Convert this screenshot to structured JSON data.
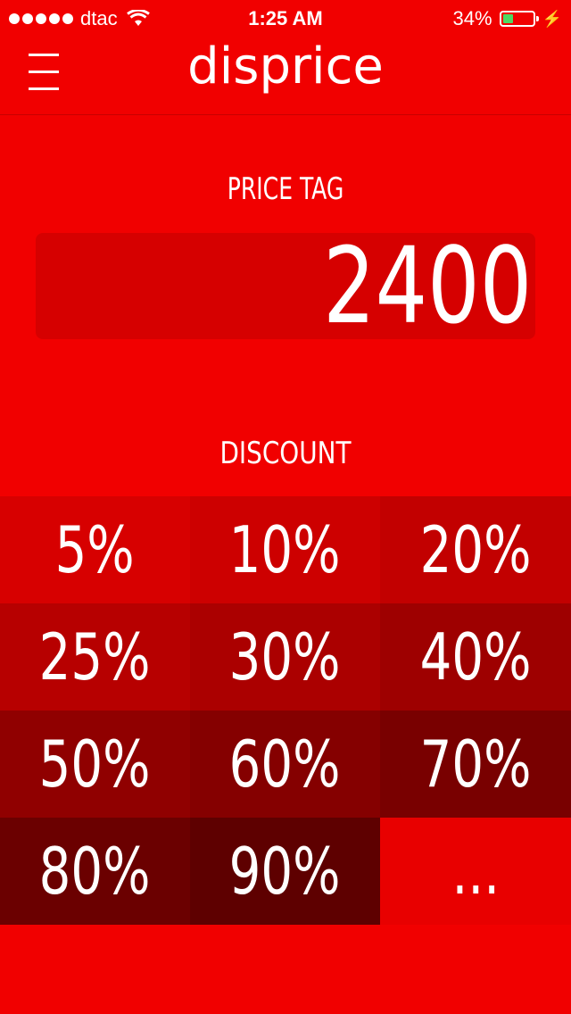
{
  "status_bar": {
    "carrier": "dtac",
    "time": "1:25 AM",
    "battery_percent": "34%",
    "battery_level": 0.34
  },
  "header": {
    "title": "disprice",
    "menu_icon": "hamburger-menu-icon"
  },
  "price_tag": {
    "label": "PRICE TAG",
    "value": "2400"
  },
  "discount": {
    "label": "DISCOUNT",
    "options": [
      "5%",
      "10%",
      "20%",
      "25%",
      "30%",
      "40%",
      "50%",
      "60%",
      "70%",
      "80%",
      "90%",
      "..."
    ],
    "colors": [
      "#d70000",
      "#cd0000",
      "#c20000",
      "#b70000",
      "#ab0000",
      "#9e0000",
      "#900000",
      "#850000",
      "#790000",
      "#6b0000",
      "#5e0000",
      "#e80000"
    ]
  }
}
